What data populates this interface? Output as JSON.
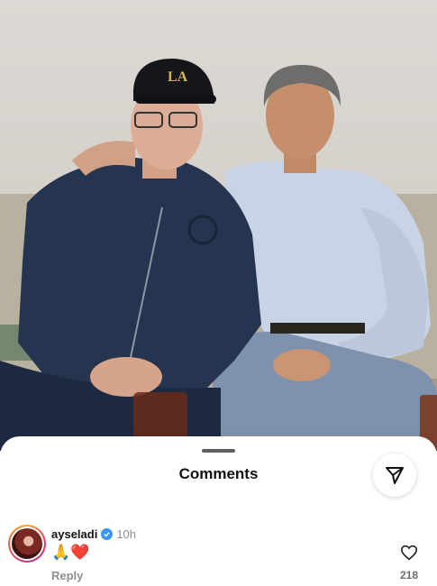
{
  "sheet": {
    "title": "Comments",
    "share_icon": "send-paper-plane-icon"
  },
  "photo": {
    "cap_text": "LA"
  },
  "comment": {
    "username": "ayseladi",
    "verified": true,
    "time": "10h",
    "text": "🙏❤️",
    "reply_label": "Reply",
    "like_count": "218",
    "like_icon": "heart-outline-icon"
  },
  "colors": {
    "verified_badge": "#3897f0",
    "muted_text": "#8e8e8e",
    "sheet_bg": "#ffffff"
  }
}
